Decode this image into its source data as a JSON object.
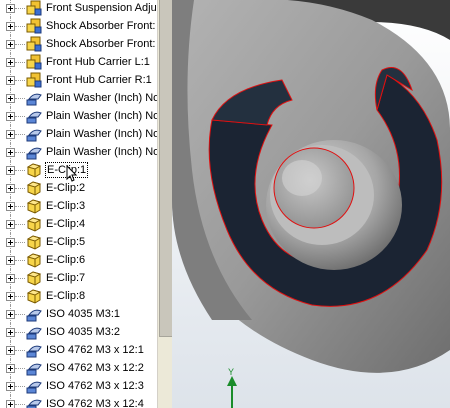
{
  "tree": {
    "items": [
      {
        "label": "Front Suspension Adju",
        "icon": "assembly-icon"
      },
      {
        "label": "Shock Absorber Front:",
        "icon": "assembly-icon"
      },
      {
        "label": "Shock Absorber Front:",
        "icon": "assembly-icon"
      },
      {
        "label": "Front Hub Carrier L:1",
        "icon": "assembly-icon"
      },
      {
        "label": "Front Hub Carrier R:1",
        "icon": "assembly-icon"
      },
      {
        "label": "Plain Washer (Inch) No",
        "icon": "washer-part-icon"
      },
      {
        "label": "Plain Washer (Inch) No",
        "icon": "washer-part-icon"
      },
      {
        "label": "Plain Washer (Inch) No",
        "icon": "washer-part-icon"
      },
      {
        "label": "Plain Washer (Inch) No",
        "icon": "washer-part-icon"
      },
      {
        "label": "E-Clip:1",
        "icon": "part-icon",
        "selected": true
      },
      {
        "label": "E-Clip:2",
        "icon": "part-icon"
      },
      {
        "label": "E-Clip:3",
        "icon": "part-icon"
      },
      {
        "label": "E-Clip:4",
        "icon": "part-icon"
      },
      {
        "label": "E-Clip:5",
        "icon": "part-icon"
      },
      {
        "label": "E-Clip:6",
        "icon": "part-icon"
      },
      {
        "label": "E-Clip:7",
        "icon": "part-icon"
      },
      {
        "label": "E-Clip:8",
        "icon": "part-icon"
      },
      {
        "label": "ISO 4035 M3:1",
        "icon": "washer-part-icon"
      },
      {
        "label": "ISO 4035 M3:2",
        "icon": "washer-part-icon"
      },
      {
        "label": "ISO 4762 M3 x 12:1",
        "icon": "washer-part-icon"
      },
      {
        "label": "ISO 4762 M3 x 12:2",
        "icon": "washer-part-icon"
      },
      {
        "label": "ISO 4762 M3 x 12:3",
        "icon": "washer-part-icon"
      },
      {
        "label": "ISO 4762 M3 x 12:4",
        "icon": "washer-part-icon"
      }
    ]
  },
  "viewport": {
    "axis_label": "Y",
    "colors": {
      "edge_highlight": "#e01010",
      "axis": "#1a8c2a",
      "body": "#9a9a9a",
      "slot": "#1b2433"
    }
  }
}
